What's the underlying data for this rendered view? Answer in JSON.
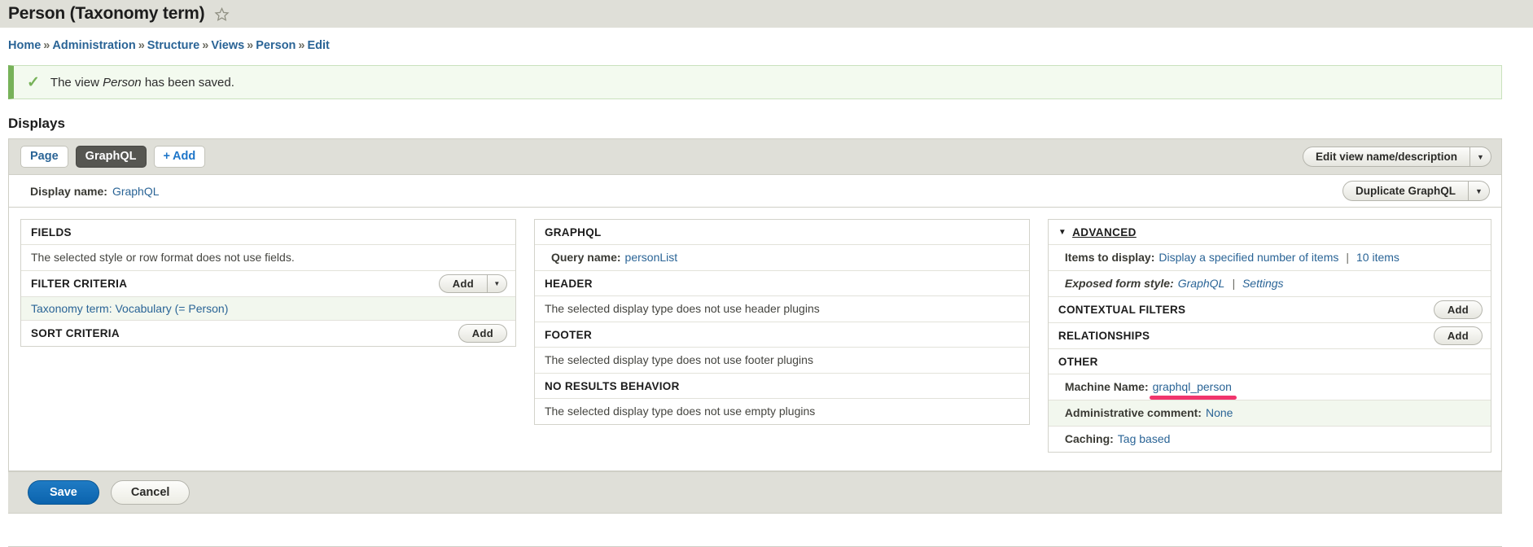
{
  "header": {
    "title": "Person (Taxonomy term)",
    "star_icon": "star-outline-icon"
  },
  "breadcrumb": {
    "separator": "»",
    "items": [
      {
        "label": "Home"
      },
      {
        "label": "Administration"
      },
      {
        "label": "Structure"
      },
      {
        "label": "Views"
      },
      {
        "label": "Person"
      },
      {
        "label": "Edit"
      }
    ]
  },
  "status_message": {
    "icon": "check-icon",
    "text_before": "The view ",
    "emphasis": "Person",
    "text_after": " has been saved."
  },
  "displays": {
    "heading": "Displays",
    "tabs": [
      {
        "label": "Page",
        "active": false
      },
      {
        "label": "GraphQL",
        "active": true
      }
    ],
    "add_tab": {
      "plus": "+",
      "label": "Add"
    },
    "edit_view_button": {
      "label": "Edit view name/description",
      "arrow": "▼"
    },
    "display_name": {
      "label": "Display name:",
      "value": "GraphQL"
    },
    "duplicate_button": {
      "label": "Duplicate GraphQL",
      "arrow": "▼"
    }
  },
  "left_column": {
    "fields": {
      "heading": "FIELDS",
      "body": "The selected style or row format does not use fields."
    },
    "filter_criteria": {
      "heading": "FILTER CRITERIA",
      "add_button": {
        "label": "Add",
        "arrow": "▼"
      },
      "rows": [
        {
          "label": "Taxonomy term: Vocabulary (= Person)"
        }
      ]
    },
    "sort_criteria": {
      "heading": "SORT CRITERIA",
      "add_button": {
        "label": "Add"
      }
    }
  },
  "middle_column": {
    "graphql": {
      "heading": "GRAPHQL",
      "query_name_label": "Query name:",
      "query_name_value": "personList"
    },
    "header": {
      "heading": "HEADER",
      "body": "The selected display type does not use header plugins"
    },
    "footer": {
      "heading": "FOOTER",
      "body": "The selected display type does not use footer plugins"
    },
    "no_results": {
      "heading": "NO RESULTS BEHAVIOR",
      "body": "The selected display type does not use empty plugins"
    }
  },
  "right_column": {
    "advanced": {
      "triangle": "▼",
      "heading": "ADVANCED",
      "items_to_display": {
        "label": "Items to display:",
        "value": "Display a specified number of items",
        "separator": "|",
        "count": "10 items"
      },
      "exposed_form_style": {
        "label": "Exposed form style:",
        "value": "GraphQL",
        "separator": "|",
        "settings": "Settings"
      }
    },
    "contextual_filters": {
      "heading": "CONTEXTUAL FILTERS",
      "add_button": {
        "label": "Add"
      }
    },
    "relationships": {
      "heading": "RELATIONSHIPS",
      "add_button": {
        "label": "Add"
      }
    },
    "other": {
      "heading": "OTHER",
      "machine_name": {
        "label": "Machine Name:",
        "value": "graphql_person",
        "annotated": true
      },
      "administrative_comment": {
        "label": "Administrative comment:",
        "value": "None"
      },
      "caching": {
        "label": "Caching:",
        "value": "Tag based"
      }
    }
  },
  "actions": {
    "save_label": "Save",
    "cancel_label": "Cancel"
  },
  "colors": {
    "link": "#2a6496",
    "accent_blue": "#0b63ad",
    "status_green": "#77b259",
    "annotation_pink": "#f1356d",
    "chrome_gray": "#dfdfd8",
    "active_tab": "#565651"
  }
}
